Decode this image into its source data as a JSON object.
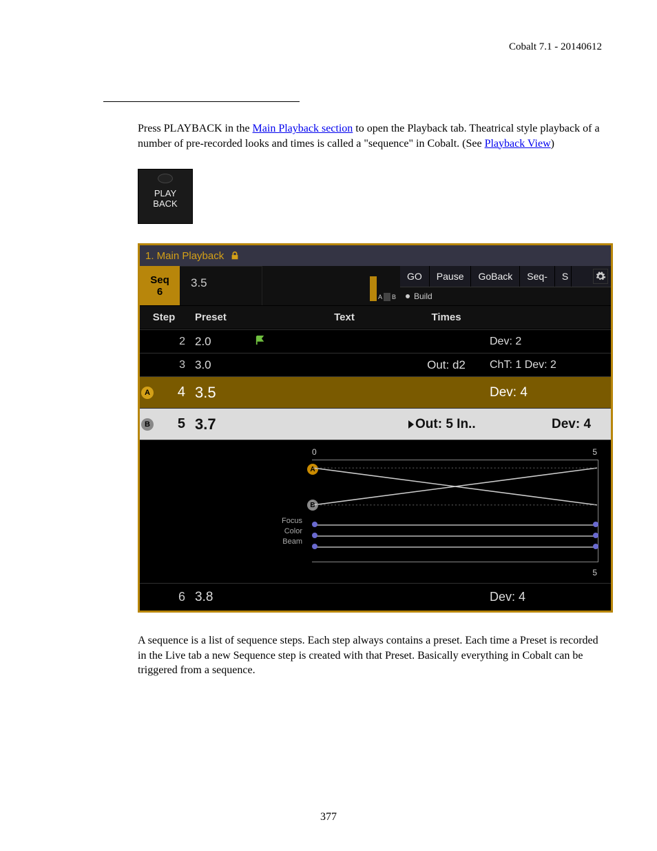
{
  "doc": {
    "header": "Cobalt 7.1 - 20140612",
    "page_number": "377",
    "para1_pre": "Press PLAYBACK in the ",
    "para1_link1": "Main Playback section",
    "para1_mid": " to open the Playback tab. Theatrical style playback of a number of pre-recorded looks and times is called a \"sequence\" in Cobalt. (See ",
    "para1_link2": "Playback View",
    "para1_post": ")",
    "para2": "A sequence is a list of sequence steps. Each step always contains a preset. Each time a Preset is recorded in the Live tab a new Sequence step is created with that Preset. Basically everything in Cobalt can be triggered from a sequence."
  },
  "playback_button": {
    "line1": "PLAY",
    "line2": "BACK"
  },
  "shot": {
    "title": "1. Main Playback",
    "seq_label": "Seq",
    "seq_num": "6",
    "current_preset": "3.5",
    "ab_a": "A",
    "ab_b": "B",
    "controls": {
      "go": "GO",
      "pause": "Pause",
      "goback": "GoBack",
      "seqminus": "Seq-",
      "s_trunc": "S",
      "build": "Build"
    },
    "cols": {
      "step": "Step",
      "preset": "Preset",
      "text": "Text",
      "times": "Times"
    },
    "rows": [
      {
        "step": "2",
        "preset": "2.0",
        "flag": true,
        "times": "",
        "extra": "Dev: 2"
      },
      {
        "step": "3",
        "preset": "3.0",
        "times": "Out: d2",
        "extra": "ChT: 1   Dev: 2"
      },
      {
        "badge": "A",
        "step": "4",
        "preset": "3.5",
        "times": "",
        "extra": "Dev: 4",
        "cls": "row-a"
      },
      {
        "badge": "B",
        "step": "5",
        "preset": "3.7",
        "times_pre": "Out: 5   In..",
        "extra": "Dev: 4",
        "cls": "row-b"
      },
      {
        "step": "6",
        "preset": "3.8",
        "times": "",
        "extra": "Dev: 4"
      }
    ],
    "timeline": {
      "scale_left": "0",
      "scale_right_top": "5",
      "scale_right_bottom": "5",
      "focus": "Focus",
      "color": "Color",
      "beam": "Beam"
    }
  }
}
